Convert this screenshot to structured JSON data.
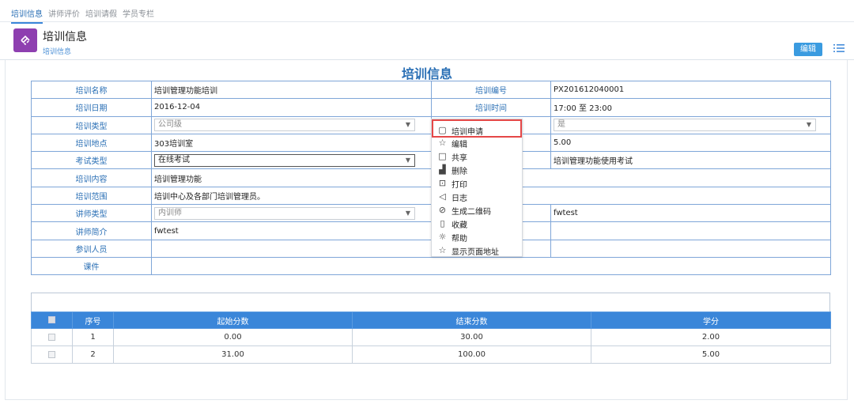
{
  "top_tabs": [
    "培训信息",
    "讲师评价",
    "培训请假",
    "学员专栏"
  ],
  "header": {
    "title": "培训信息",
    "breadcrumb": "培训信息",
    "edit_label": "编辑"
  },
  "form": {
    "title": "培训信息",
    "rows": [
      {
        "label": "培训名称",
        "value": "培训管理功能培训",
        "label2": "培训编号",
        "value2": "PX201612040001"
      },
      {
        "label": "培训日期",
        "value": "2016-12-04",
        "label2": "培训时间",
        "value2": "17:00 至 23:00"
      },
      {
        "label": "培训类型",
        "select": "公司级",
        "value2_select": "是"
      },
      {
        "label": "培训地点",
        "value": "303培训室",
        "value2": "5.00"
      },
      {
        "label": "考试类型",
        "select": "在线考试",
        "value2": "培训管理功能使用考试"
      },
      {
        "label": "培训内容",
        "value": "培训管理功能"
      },
      {
        "label": "培训范围",
        "value": "培训中心及各部门培训管理员。"
      },
      {
        "label": "讲师类型",
        "select": "内训师",
        "value2": "fwtest"
      },
      {
        "label": "讲师简介",
        "value": "fwtest"
      },
      {
        "label": "参训人员",
        "value": ""
      },
      {
        "label": "课件",
        "value": ""
      }
    ]
  },
  "context_menu": [
    {
      "icon": "square-rounded-icon",
      "label": "培训申请"
    },
    {
      "icon": "star-icon",
      "label": "编辑"
    },
    {
      "icon": "window-icon",
      "label": "共享"
    },
    {
      "icon": "bar-chart-icon",
      "label": "删除"
    },
    {
      "icon": "print-icon",
      "label": "打印"
    },
    {
      "icon": "send-icon",
      "label": "日志"
    },
    {
      "icon": "check-circle-icon",
      "label": "生成二维码"
    },
    {
      "icon": "document-icon",
      "label": "收藏"
    },
    {
      "icon": "sun-icon",
      "label": "帮助"
    },
    {
      "icon": "star-outline-icon",
      "label": "显示页面地址"
    }
  ],
  "grid": {
    "headers": [
      "序号",
      "起始分数",
      "结束分数",
      "学分"
    ],
    "rows": [
      {
        "no": "1",
        "start": "0.00",
        "end": "30.00",
        "credit": "2.00"
      },
      {
        "no": "2",
        "start": "31.00",
        "end": "100.00",
        "credit": "5.00"
      }
    ]
  },
  "colors": {
    "accent": "#3a86d9",
    "title_blue": "#2a6fb5",
    "app_icon": "#8e3fb0",
    "highlight": "#e54848"
  }
}
